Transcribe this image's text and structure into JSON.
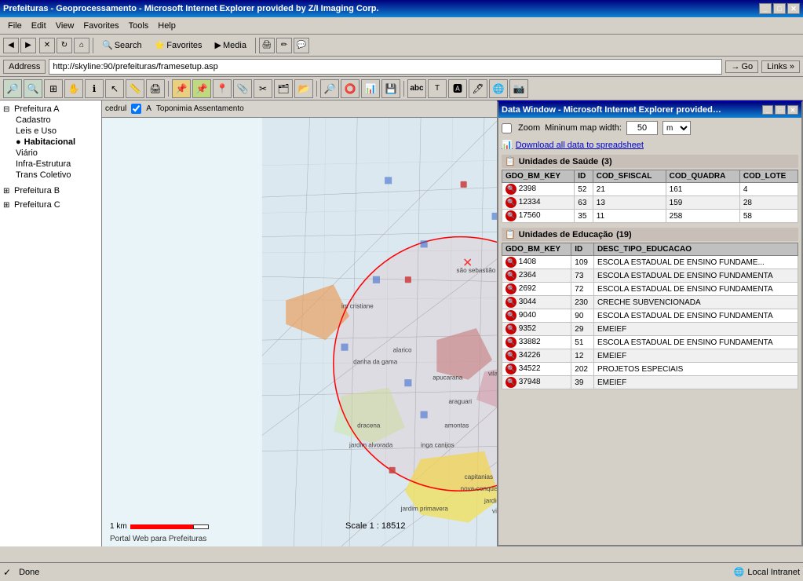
{
  "titlebar": {
    "title": "Prefeituras - Geoprocessamento - Microsoft Internet Explorer provided by Z/I Imaging Corp.",
    "min": "_",
    "max": "□",
    "close": "✕"
  },
  "menubar": {
    "items": [
      "File",
      "Edit",
      "View",
      "Favorites",
      "Tools",
      "Help"
    ]
  },
  "toolbar": {
    "back": "Back",
    "forward": "▶",
    "search": "Search",
    "favorites": "Favorites",
    "media": "Media",
    "address_label": "Address",
    "address_url": "http://skyline:90/prefeituras/framesetup.asp",
    "go": "Go",
    "links": "Links »"
  },
  "left_panel": {
    "tree": [
      {
        "label": "Prefeitura A",
        "expanded": true,
        "children": [
          "Cadastro",
          "Leis e Uso",
          "Habitacional",
          "Viário",
          "Infra-Estrutura",
          "Trans Coletivo"
        ]
      },
      {
        "label": "Prefeitura B",
        "expanded": false
      },
      {
        "label": "Prefeitura C",
        "expanded": false
      }
    ]
  },
  "map": {
    "footer": "Portal Web para Prefeituras",
    "scale_label": "1 km",
    "scale_text": "Scale 1 : 18512",
    "topbar": {
      "layer_label": "cedrul",
      "checkbox_label": "A",
      "description": "Toponimia Assentamento"
    }
  },
  "data_window": {
    "title": "Data Window - Microsoft Internet Explorer provided by...",
    "zoom_label": "Zoom",
    "min_width_label": "Mininum map width:",
    "min_width_value": "50",
    "unit": "m",
    "download_link": "Download all data to spreadsheet",
    "section1": {
      "title": "Unidades de Saúde",
      "count": "(3)",
      "columns": [
        "GDO_BM_KEY",
        "ID",
        "COD_SFISCAL",
        "COD_QUADRA",
        "COD_LOTE"
      ],
      "rows": [
        {
          "key": "2398",
          "id": "52",
          "sfiscal": "21",
          "quadra": "161",
          "lote": "4"
        },
        {
          "key": "12334",
          "id": "63",
          "sfiscal": "13",
          "quadra": "159",
          "lote": "28"
        },
        {
          "key": "17560",
          "id": "35",
          "sfiscal": "11",
          "quadra": "258",
          "lote": "58"
        }
      ]
    },
    "section2": {
      "title": "Unidades de Educação",
      "count": "(19)",
      "columns": [
        "GDO_BM_KEY",
        "ID",
        "DESC_TIPO_EDUCACAO"
      ],
      "rows": [
        {
          "key": "1408",
          "id": "109",
          "desc": "ESCOLA ESTADUAL DE ENSINO FUNDAME..."
        },
        {
          "key": "2364",
          "id": "73",
          "desc": "ESCOLA ESTADUAL DE ENSINO FUNDAMENTA"
        },
        {
          "key": "2692",
          "id": "72",
          "desc": "ESCOLA ESTADUAL DE ENSINO FUNDAMENTA"
        },
        {
          "key": "3044",
          "id": "230",
          "desc": "CRECHE SUBVENCIONADA"
        },
        {
          "key": "9040",
          "id": "90",
          "desc": "ESCOLA ESTADUAL DE ENSINO FUNDAMENTA"
        },
        {
          "key": "9352",
          "id": "29",
          "desc": "EMEIEF"
        },
        {
          "key": "33882",
          "id": "51",
          "desc": "ESCOLA ESTADUAL DE ENSINO FUNDAMENTA"
        },
        {
          "key": "34226",
          "id": "12",
          "desc": "EMEIEF"
        },
        {
          "key": "34522",
          "id": "202",
          "desc": "PROJETOS ESPECIAIS"
        },
        {
          "key": "37948",
          "id": "39",
          "desc": "EMEIEF"
        }
      ]
    }
  },
  "statusbar": {
    "status": "Done",
    "right": "Local Intranet"
  },
  "colors": {
    "titlebar_start": "#000080",
    "titlebar_end": "#1084d0",
    "accent": "#0000aa"
  }
}
